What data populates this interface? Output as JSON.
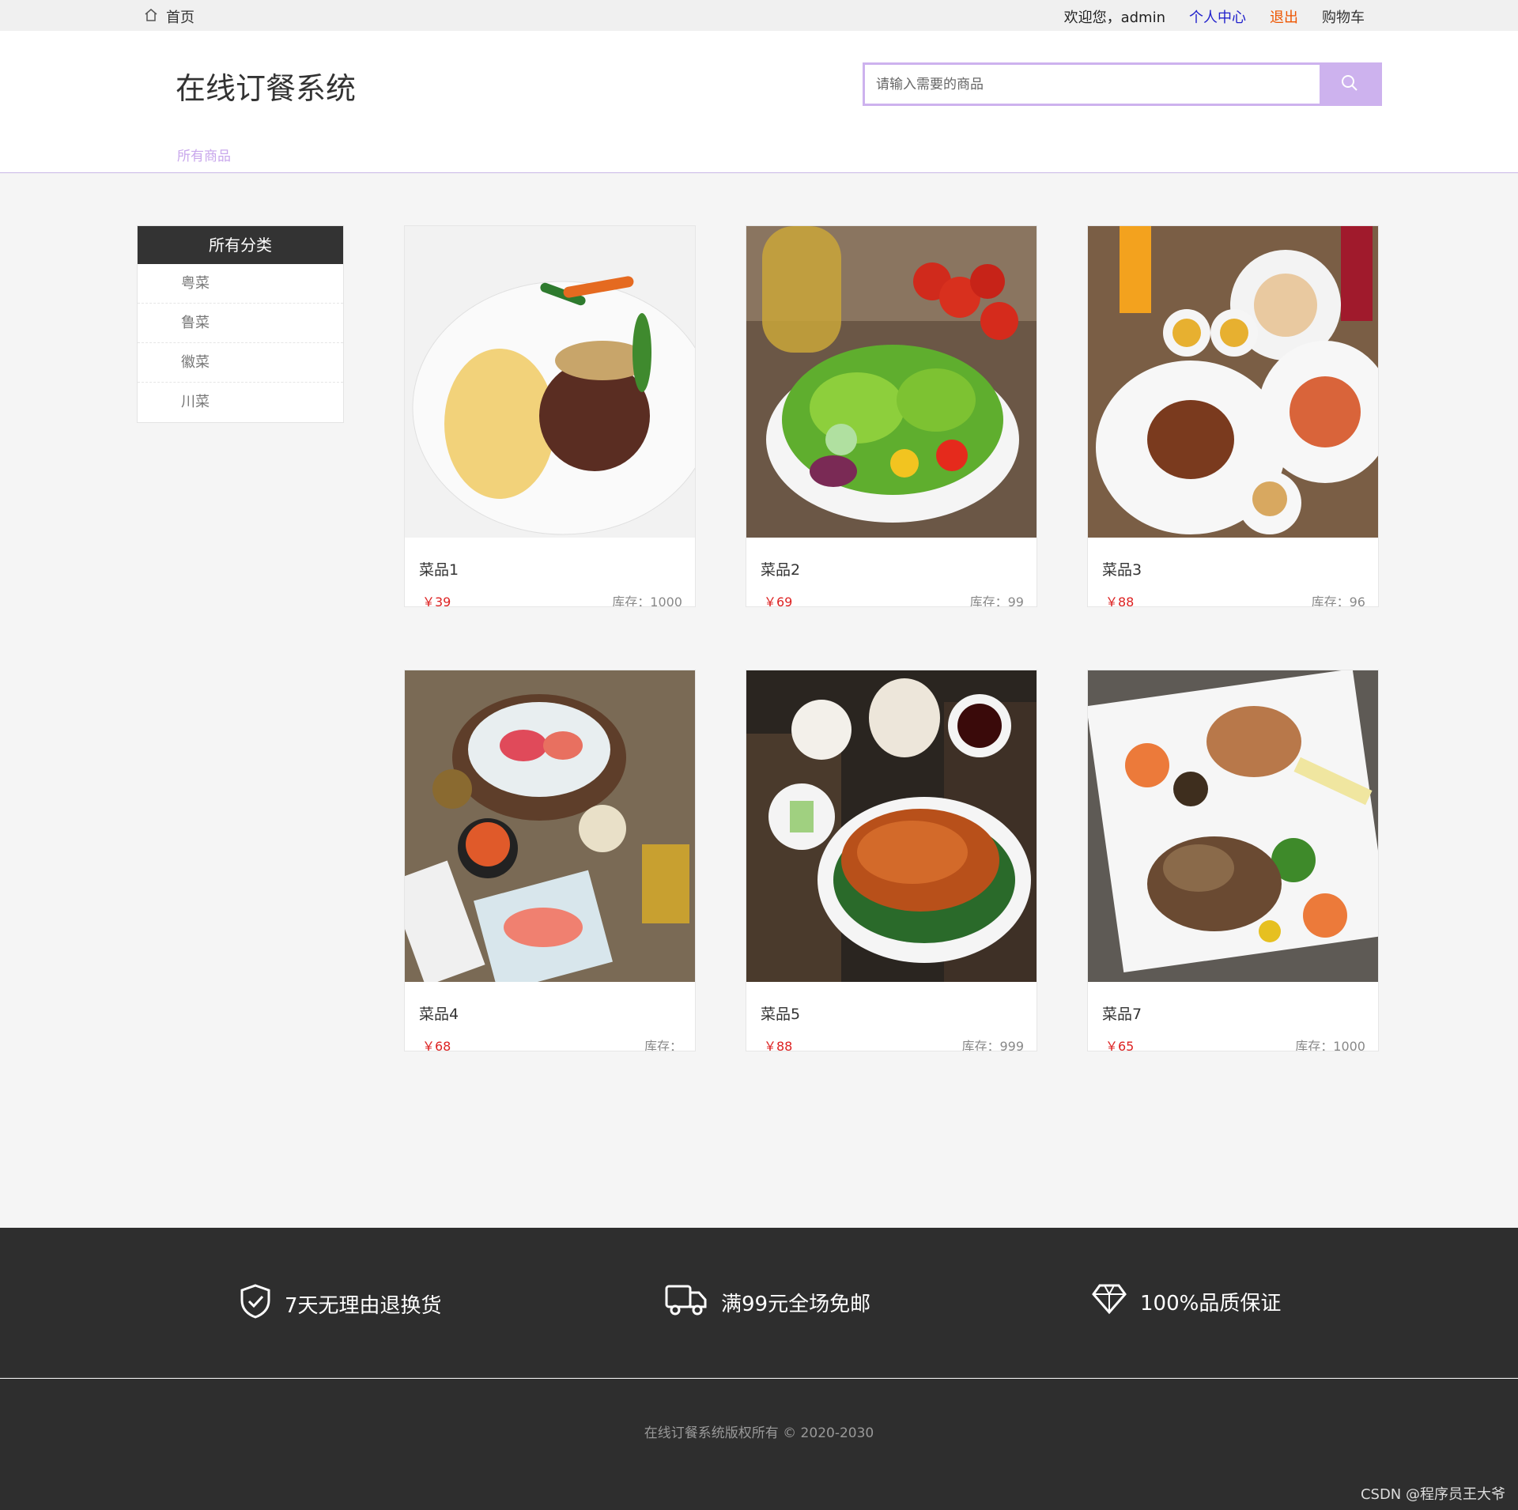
{
  "topbar": {
    "home_icon": "home-icon",
    "home_label": "首页",
    "welcome": "欢迎您，admin",
    "personal_center": "个人中心",
    "logout": "退出",
    "cart": "购物车"
  },
  "header": {
    "logo": "在线订餐系统",
    "search_placeholder": "请输入需要的商品",
    "search_icon": "search-icon",
    "nav_all_products": "所有商品"
  },
  "sidebar": {
    "title": "所有分类",
    "items": [
      "粤菜",
      "鲁菜",
      "徽菜",
      "川菜"
    ]
  },
  "products": [
    {
      "name": "菜品1",
      "price": "￥39",
      "stock": "库存：1000"
    },
    {
      "name": "菜品2",
      "price": "￥69",
      "stock": "库存：99"
    },
    {
      "name": "菜品3",
      "price": "￥88",
      "stock": "库存：96"
    },
    {
      "name": "菜品4",
      "price": "￥68",
      "stock": "库存："
    },
    {
      "name": "菜品5",
      "price": "￥88",
      "stock": "库存：999"
    },
    {
      "name": "菜品7",
      "price": "￥65",
      "stock": "库存：1000"
    }
  ],
  "footer": {
    "features": [
      {
        "icon": "shield-check-icon",
        "label": "7天无理由退换货"
      },
      {
        "icon": "truck-icon",
        "label": "满99元全场免邮"
      },
      {
        "icon": "diamond-icon",
        "label": "100%品质保证"
      }
    ],
    "copyright": "在线订餐系统版权所有 © 2020-2030",
    "watermark": "CSDN @程序员王大爷"
  },
  "colors": {
    "accent": "#cdb2ee",
    "price": "#dd2222",
    "footer_bg": "#2e2e2e"
  }
}
